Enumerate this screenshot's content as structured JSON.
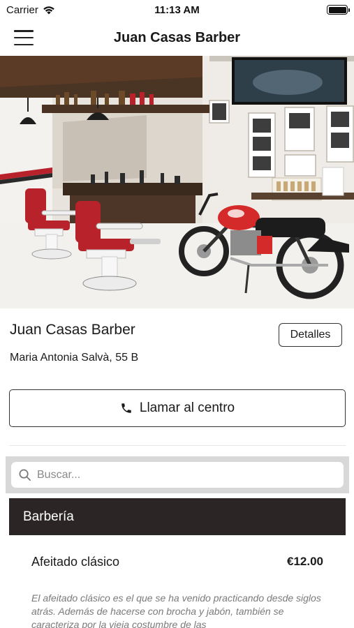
{
  "status_bar": {
    "carrier": "Carrier",
    "time": "11:13 AM"
  },
  "header": {
    "title": "Juan Casas Barber"
  },
  "shop": {
    "name": "Juan Casas Barber",
    "details_label": "Detalles",
    "address": "Maria Antonia Salvà, 55 B",
    "call_label": "Llamar al centro"
  },
  "search": {
    "placeholder": "Buscar..."
  },
  "category": {
    "title": "Barbería"
  },
  "service": {
    "name": "Afeitado clásico",
    "price": "€12.00",
    "description": "El afeitado clásico es el que se ha venido practicando desde siglos atrás. Además de hacerse con brocha y jabón, también se caracteriza por la vieja costumbre de las"
  },
  "colors": {
    "category_bg": "#2c2525",
    "search_bg": "#d8d8d8",
    "chair_red": "#b8232b",
    "motorcycle_red": "#d42a2a"
  },
  "icons": {
    "menu": "hamburger-menu-icon",
    "wifi": "wifi-icon",
    "battery": "battery-icon",
    "phone": "phone-icon",
    "search": "search-icon"
  }
}
